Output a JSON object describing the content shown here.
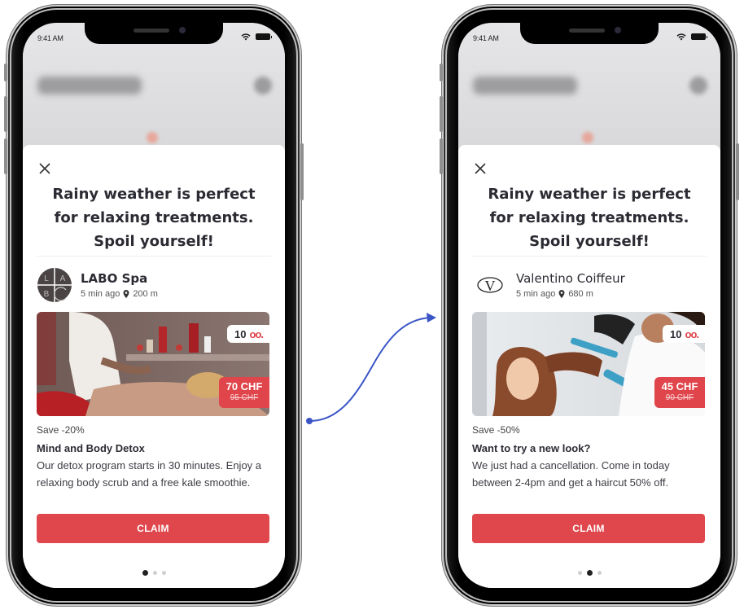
{
  "status_bar": {
    "time": "9:41 AM"
  },
  "theme": {
    "accent": "#df474c",
    "text": "#2b2b33",
    "connector": "#3b55c6"
  },
  "screens": [
    {
      "close_icon": "close-icon",
      "headline": "Rainy weather is perfect for relaxing treatments. Spoil yourself!",
      "merchant": {
        "name": "LABO Spa",
        "time_ago": "5 min ago",
        "distance": "200 m",
        "logo": "labo-spa-logo"
      },
      "image": {
        "subject": "massage-treatment-photo"
      },
      "points_badge": {
        "value": "10",
        "logo_text": "oo."
      },
      "price": {
        "current": "70 CHF",
        "original": "95 CHF"
      },
      "save_text": "Save -20%",
      "offer_title": "Mind and Body Detox",
      "offer_description": "Our detox program starts in 30 minutes. Enjoy a relaxing body scrub and a free kale smoothie.",
      "claim_label": "CLAIM",
      "pager": {
        "total": 3,
        "active": 1
      }
    },
    {
      "close_icon": "close-icon",
      "headline": "Rainy weather is perfect for relaxing treatments. Spoil yourself!",
      "merchant": {
        "name": "Valentino Coiffeur",
        "time_ago": "5 min ago",
        "distance": "680 m",
        "logo": "valentino-logo"
      },
      "image": {
        "subject": "hair-styling-photo"
      },
      "points_badge": {
        "value": "10",
        "logo_text": "oo."
      },
      "price": {
        "current": "45 CHF",
        "original": "90 CHF"
      },
      "save_text": "Save -50%",
      "offer_title": "Want to try a new look?",
      "offer_description": "We just had a cancellation. Come in today between 2-4pm and get a haircut 50% off.",
      "claim_label": "CLAIM",
      "pager": {
        "total": 3,
        "active": 2
      }
    }
  ]
}
